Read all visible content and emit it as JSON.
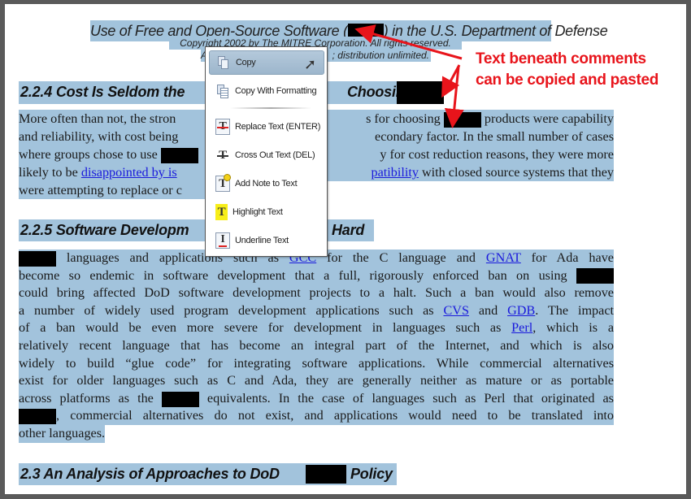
{
  "document": {
    "title_left": "Use of Free and Open-Source Software (",
    "title_right": ") in the U.S. Department of Defense",
    "copyright": "Copyright 2002 by The MITRE Corporation. All rights reserved.",
    "release_left": "A",
    "release_right": "; distribution unlimited.",
    "h224_left": "2.2.4  Cost Is Seldom the",
    "h224_right": "Choosing",
    "para1": [
      {
        "left": [
          {
            "t": "More often than not, the stron"
          }
        ],
        "right": [
          {
            "t": "s for choosing "
          },
          {
            "r": 1
          },
          {
            "t": " products were capability"
          }
        ]
      },
      {
        "left": [
          {
            "t": "and reliability, with cost being"
          }
        ],
        "right": [
          {
            "t": "econdary factor. In the small number of cases"
          }
        ]
      },
      {
        "left": [
          {
            "t": "where groups chose to use "
          },
          {
            "r": 1
          }
        ],
        "right": [
          {
            "t": "y for cost reduction reasons, they were more"
          }
        ]
      },
      {
        "left": [
          {
            "t": "likely to be "
          },
          {
            "a": "disappointed by is"
          }
        ],
        "right": [
          {
            "a": "patibility"
          },
          {
            "t": " with closed source systems that they"
          }
        ]
      },
      {
        "left": [
          {
            "t": "were attempting to replace or c"
          }
        ],
        "last": true
      }
    ],
    "h225_left": "2.2.5  Software Developm",
    "h225_right": "Hard",
    "para2": [
      {
        "full": [
          {
            "r": 1
          },
          {
            "t": " languages and applications such as "
          },
          {
            "a": "GCC"
          },
          {
            "t": " for the C language and "
          },
          {
            "a": "GNAT"
          },
          {
            "t": " for Ada have"
          }
        ]
      },
      {
        "full": [
          {
            "t": "become so endemic in software development that a full, rigorously enforced ban on using "
          },
          {
            "r": 1
          }
        ]
      },
      {
        "full": [
          {
            "t": "could bring affected DoD software development projects to a halt. Such a ban would also remove"
          }
        ]
      },
      {
        "full": [
          {
            "t": "a number of widely used program development applications such as "
          },
          {
            "a": "CVS"
          },
          {
            "t": " and "
          },
          {
            "a": "GDB"
          },
          {
            "t": ". The impact"
          }
        ]
      },
      {
        "full": [
          {
            "t": "of a ban would be even more severe for development in languages such as "
          },
          {
            "a": "Perl"
          },
          {
            "t": ", which is a"
          }
        ]
      },
      {
        "full": [
          {
            "t": "relatively recent language that has become an integral part of the Internet, and which is also"
          }
        ]
      },
      {
        "full": [
          {
            "t": "widely to build “glue code” for integrating software applications. While commercial alternatives"
          }
        ]
      },
      {
        "full": [
          {
            "t": "exist for older languages such as C and Ada, they are generally neither as mature or as portable"
          }
        ]
      },
      {
        "full": [
          {
            "t": "across platforms as the "
          },
          {
            "r": 1
          },
          {
            "t": " equivalents. In the case of languages such as Perl that originated as"
          }
        ]
      },
      {
        "full": [
          {
            "r": 1
          },
          {
            "t": ", commercial alternatives do not exist, and applications would need to be translated into"
          }
        ]
      },
      {
        "full": [
          {
            "t": "other languages."
          }
        ],
        "last": true
      }
    ],
    "h23_left": "2.3  An Analysis of Approaches to DoD",
    "h23_right": "Policy"
  },
  "context_menu": {
    "items": [
      {
        "label": "Copy",
        "icon": "copy-icon"
      },
      {
        "label": "Copy With Formatting",
        "icon": "copy-formatting-icon"
      },
      {
        "label": "Replace Text (ENTER)",
        "icon": "replace-text-icon"
      },
      {
        "label": "Cross Out Text (DEL)",
        "icon": "cross-out-icon"
      },
      {
        "label": "Add Note to Text",
        "icon": "add-note-icon"
      },
      {
        "label": "Highlight Text",
        "icon": "highlight-icon"
      },
      {
        "label": "Underline Text",
        "icon": "underline-icon"
      }
    ]
  },
  "annotation": {
    "line1": "Text beneath comments",
    "line2": "can be copied and pasted",
    "color": "#e8141b"
  },
  "colors": {
    "selection": "#a2c3dc",
    "link": "#1a1adc",
    "redaction": "#000000"
  }
}
